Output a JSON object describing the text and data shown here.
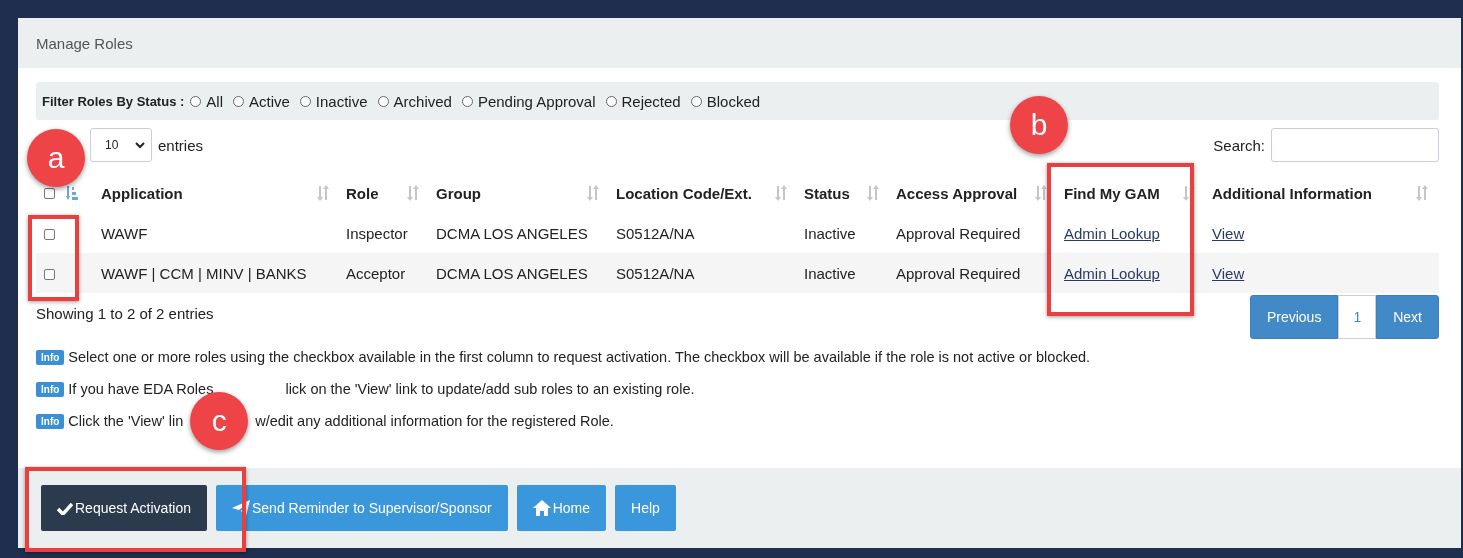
{
  "panel": {
    "title": "Manage Roles"
  },
  "filter": {
    "label": "Filter Roles By Status :",
    "options": [
      {
        "label": "All",
        "selected": false
      },
      {
        "label": "Active",
        "selected": false
      },
      {
        "label": "Inactive",
        "selected": false
      },
      {
        "label": "Archived",
        "selected": false
      },
      {
        "label": "Pending Approval",
        "selected": false
      },
      {
        "label": "Rejected",
        "selected": false
      },
      {
        "label": "Blocked",
        "selected": false
      }
    ]
  },
  "length": {
    "value": "10",
    "suffix": "entries"
  },
  "search": {
    "label": "Search:"
  },
  "table": {
    "select_all": {
      "checked": false
    },
    "columns": [
      "Application",
      "Role",
      "Group",
      "Location Code/Ext.",
      "Status",
      "Access Approval",
      "Find My GAM",
      "Additional Information"
    ],
    "rows": [
      {
        "checked": false,
        "application": "WAWF",
        "role": "Inspector",
        "group": "DCMA LOS ANGELES",
        "location": "S0512A/NA",
        "status": "Inactive",
        "approval": "Approval Required",
        "gam": "Admin Lookup",
        "info": "View"
      },
      {
        "checked": false,
        "application": "WAWF | CCM | MINV | BANKS",
        "role": "Acceptor",
        "group": "DCMA LOS ANGELES",
        "location": "S0512A/NA",
        "status": "Inactive",
        "approval": "Approval Required",
        "gam": "Admin Lookup",
        "info": "View"
      }
    ]
  },
  "summary": "Showing 1 to 2 of 2 entries",
  "pagination": [
    {
      "label": "Previous",
      "kind": "prev",
      "selected": false
    },
    {
      "label": "1",
      "kind": "page",
      "selected": true
    },
    {
      "label": "Next",
      "kind": "next",
      "selected": false
    }
  ],
  "notes": [
    {
      "badge": "Info",
      "parts": [
        "Select one or more roles using the checkbox available in the first column to request activation. The checkbox will be available if the role is not active or blocked."
      ]
    },
    {
      "badge": "Info",
      "parts": [
        "If you have EDA Roles",
        "lick on the 'View' link to update/add sub roles to an existing role."
      ]
    },
    {
      "badge": "Info",
      "parts": [
        "Click the 'View' lin",
        "w/edit any additional information for the registered Role."
      ]
    }
  ],
  "buttons": [
    {
      "label": "Request Activation",
      "kind": "request"
    },
    {
      "label": "Send Reminder to Supervisor/Sponsor",
      "kind": "reminder"
    },
    {
      "label": "Home",
      "kind": "home"
    },
    {
      "label": "Help",
      "kind": "help"
    }
  ],
  "annotations": [
    {
      "label": "a",
      "kind": "checkboxes"
    },
    {
      "label": "b",
      "kind": "gam"
    },
    {
      "label": "c",
      "kind": "request"
    }
  ]
}
